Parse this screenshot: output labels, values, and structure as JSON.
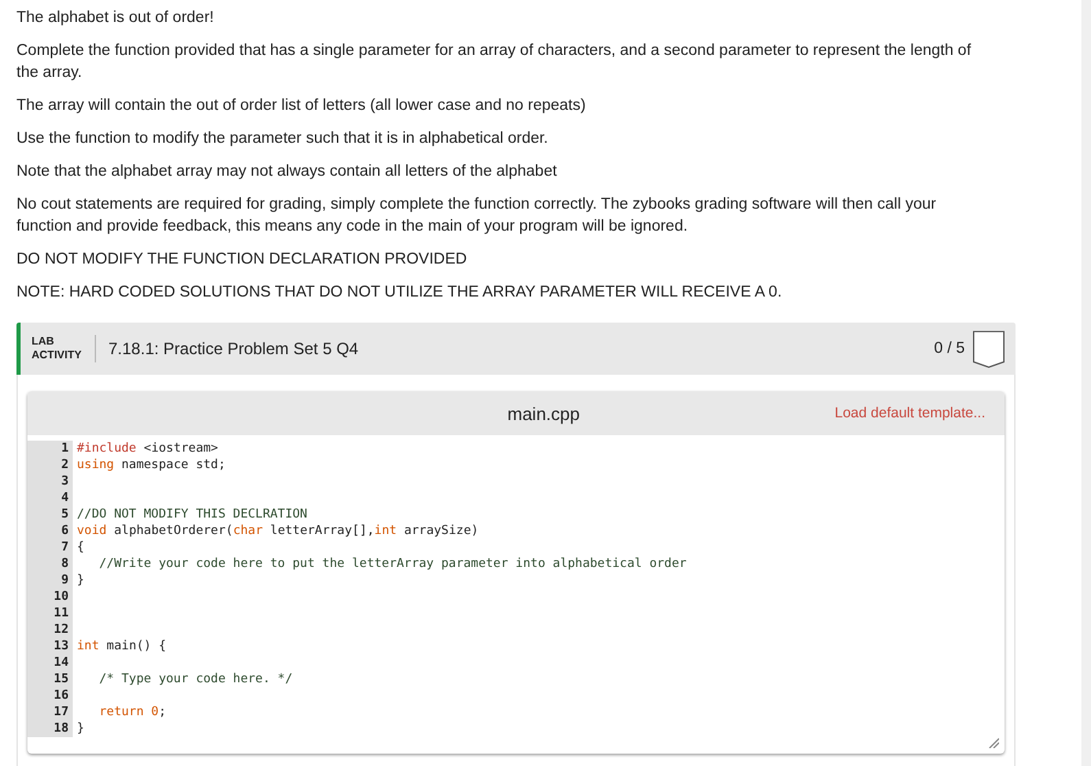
{
  "instructions": [
    "The alphabet is out of order!",
    "Complete the function provided that has a single parameter for an array of characters, and a second parameter to represent the length of the array.",
    "The array will contain the out of order list of letters (all lower case and no repeats)",
    "Use the function to modify the parameter such that it is in alphabetical order.",
    "Note that the alphabet array may not always contain all letters of the alphabet",
    "No cout statements are required for grading, simply complete the function correctly. The zybooks grading software will then call your function and provide feedback, this means any code in the main of your program will be ignored.",
    "DO NOT MODIFY THE FUNCTION DECLARATION PROVIDED",
    "NOTE: HARD CODED SOLUTIONS THAT DO NOT UTILIZE THE ARRAY PARAMETER WILL RECEIVE A 0."
  ],
  "lab": {
    "label": "LAB ACTIVITY",
    "title": "7.18.1: Practice Problem Set 5 Q4",
    "score": "0 / 5"
  },
  "editor": {
    "filename": "main.cpp",
    "load_template": "Load default template...",
    "lines": [
      {
        "number": "1",
        "tokens": [
          {
            "kind": "preproc",
            "text": "#include"
          },
          {
            "kind": "plain",
            "text": " <iostream>"
          }
        ]
      },
      {
        "number": "2",
        "tokens": [
          {
            "kind": "keyword",
            "text": "using"
          },
          {
            "kind": "plain",
            "text": " namespace std;"
          }
        ]
      },
      {
        "number": "3"
      },
      {
        "number": "4"
      },
      {
        "number": "5",
        "tokens": [
          {
            "kind": "comment",
            "text": "//DO NOT MODIFY THIS DECLRATION"
          }
        ]
      },
      {
        "number": "6",
        "tokens": [
          {
            "kind": "keyword",
            "text": "void"
          },
          {
            "kind": "plain",
            "text": " alphabetOrderer("
          },
          {
            "kind": "keyword",
            "text": "char"
          },
          {
            "kind": "plain",
            "text": " letterArray[],"
          },
          {
            "kind": "keyword",
            "text": "int"
          },
          {
            "kind": "plain",
            "text": " arraySize)"
          }
        ]
      },
      {
        "number": "7",
        "tokens": [
          {
            "kind": "plain",
            "text": "{"
          }
        ]
      },
      {
        "number": "8",
        "indent": true,
        "tokens": [
          {
            "kind": "comment",
            "text": "//Write your code here to put the letterArray parameter into alphabetical order"
          }
        ]
      },
      {
        "number": "9",
        "tokens": [
          {
            "kind": "plain",
            "text": "}"
          }
        ]
      },
      {
        "number": "10"
      },
      {
        "number": "11"
      },
      {
        "number": "12"
      },
      {
        "number": "13",
        "tokens": [
          {
            "kind": "keyword",
            "text": "int"
          },
          {
            "kind": "plain",
            "text": " main() {"
          }
        ]
      },
      {
        "number": "14"
      },
      {
        "number": "15",
        "indent": true,
        "tokens": [
          {
            "kind": "comment",
            "text": "/* Type your code here. */"
          }
        ]
      },
      {
        "number": "16"
      },
      {
        "number": "17",
        "indent": true,
        "tokens": [
          {
            "kind": "keyword",
            "text": "return"
          },
          {
            "kind": "number",
            "text": " 0"
          },
          {
            "kind": "plain",
            "text": ";"
          }
        ]
      },
      {
        "number": "18",
        "tokens": [
          {
            "kind": "plain",
            "text": "}"
          }
        ]
      }
    ]
  }
}
